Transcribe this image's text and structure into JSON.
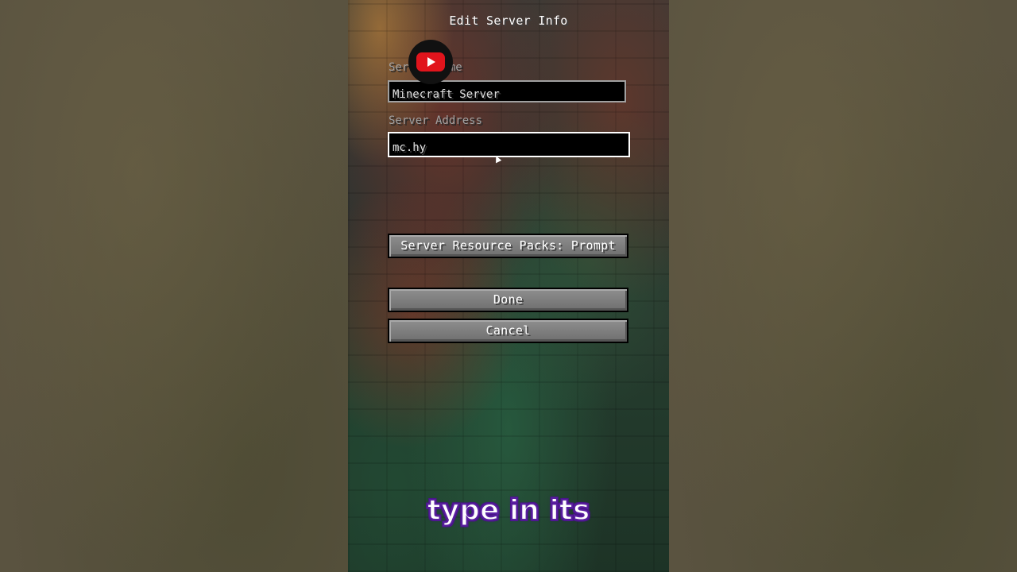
{
  "screen": {
    "title": "Edit Server Info"
  },
  "fields": {
    "server_name": {
      "label": "Server Name",
      "value": "Minecraft Server"
    },
    "server_address": {
      "label": "Server Address",
      "value": "mc.hy"
    }
  },
  "buttons": {
    "resource_packs": "Server Resource Packs: Prompt",
    "done": "Done",
    "cancel": "Cancel"
  },
  "overlay": {
    "caption": "type in its",
    "logo_icon": "youtube-logo-icon"
  },
  "colors": {
    "caption_outline": "#5a1fa0",
    "logo_red": "#e1141c",
    "field_border_focused": "#ffffff",
    "label_gray": "#a0a0a0"
  }
}
